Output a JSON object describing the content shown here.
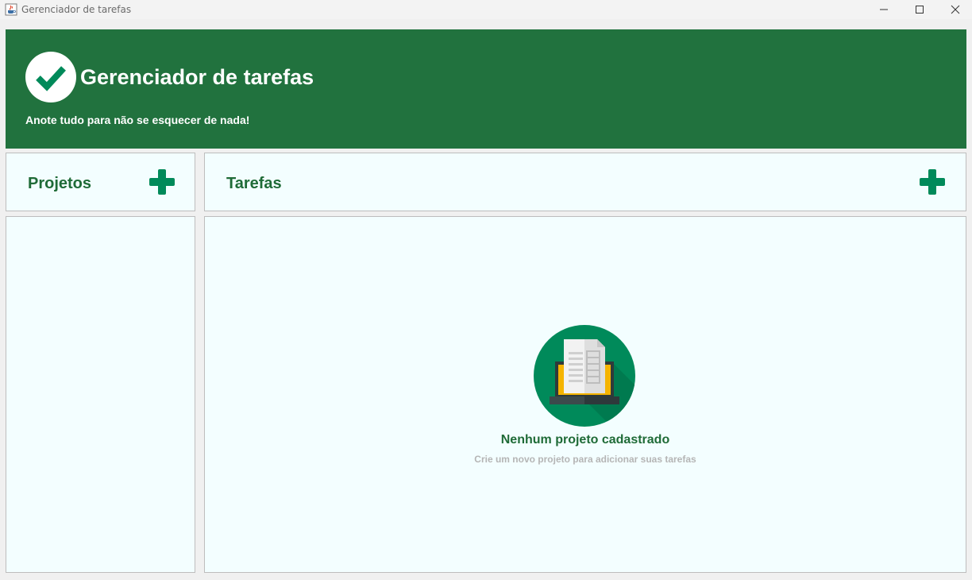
{
  "window": {
    "title": "Gerenciador de tarefas",
    "icon": "java-cup-icon",
    "controls": [
      "minimize",
      "maximize",
      "close"
    ]
  },
  "header": {
    "title": "Gerenciador de tarefas",
    "subtitle": "Anote tudo para não se esquecer de nada!",
    "logo_icon": "checkmark-icon",
    "background": "#21723e"
  },
  "projects": {
    "title": "Projetos",
    "add_icon": "plus-icon",
    "items": []
  },
  "tasks": {
    "title": "Tarefas",
    "add_icon": "plus-icon",
    "empty_state": {
      "icon": "laptop-document-icon",
      "title": "Nenhum projeto cadastrado",
      "subtitle": "Crie um novo projeto para adicionar suas tarefas"
    }
  },
  "colors": {
    "accent": "#21723e",
    "accent_text": "#1f6b37",
    "plus": "#008a5a",
    "panel_bg": "#f3feff"
  }
}
